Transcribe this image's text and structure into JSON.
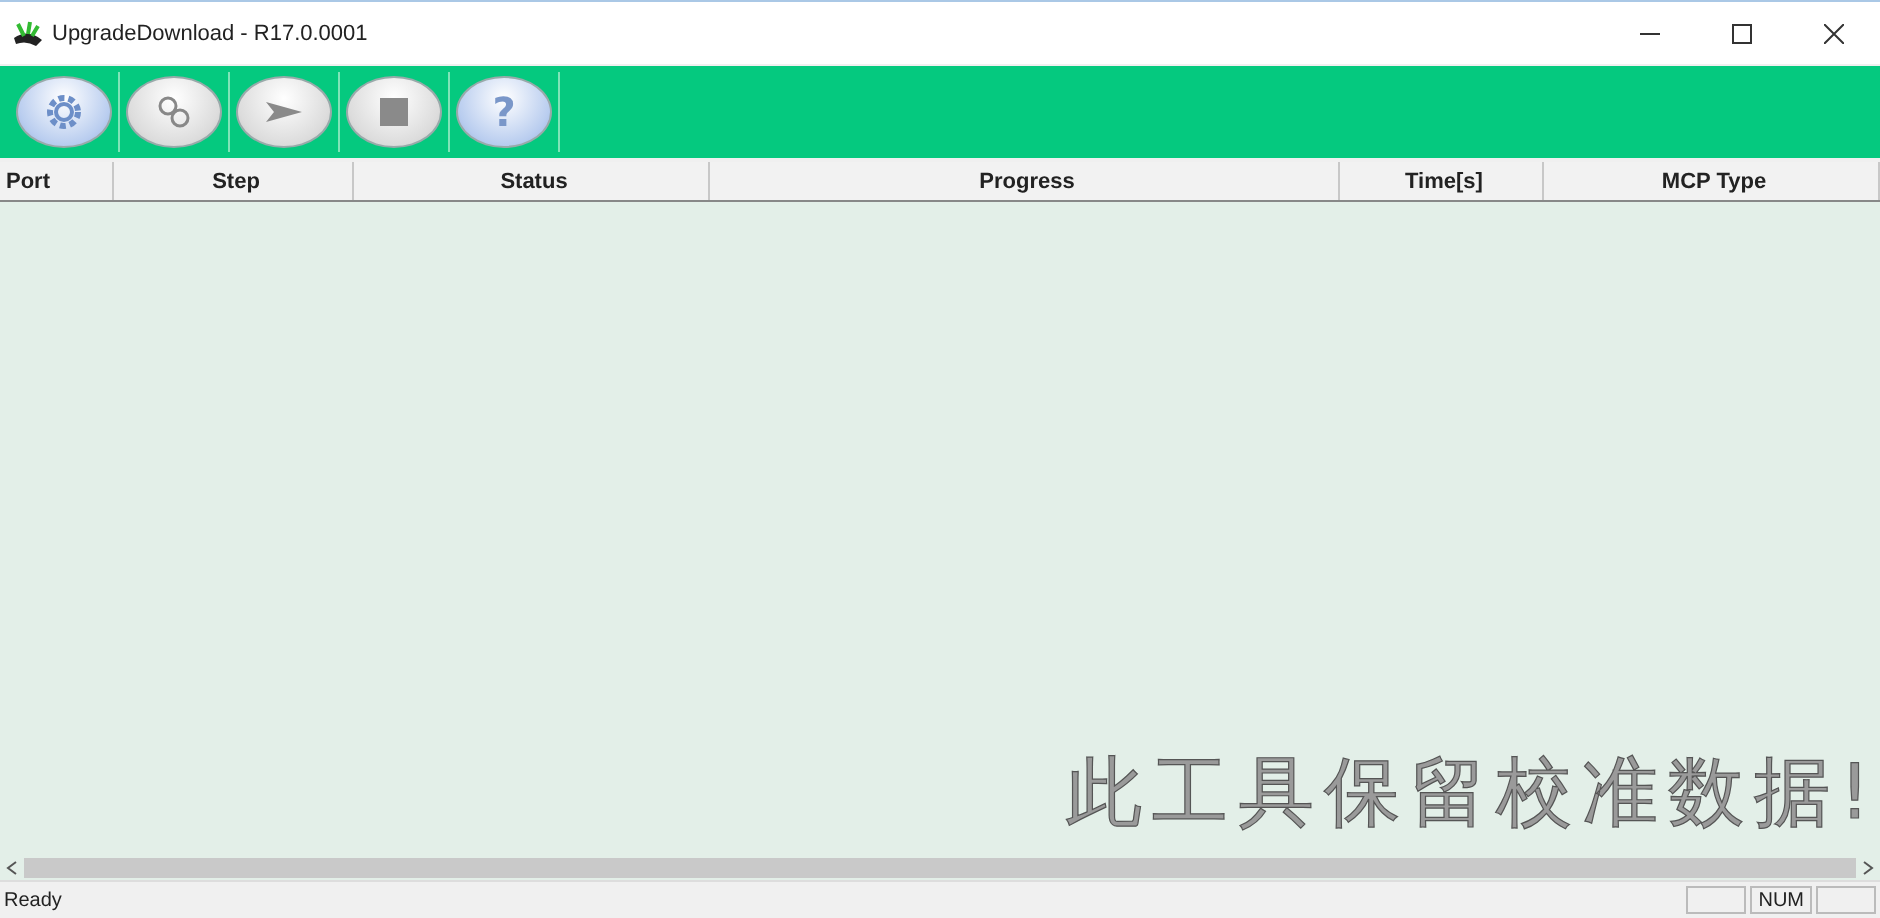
{
  "window": {
    "title": "UpgradeDownload - R17.0.0001"
  },
  "toolbar": {
    "buttons": [
      {
        "kind": "settings"
      },
      {
        "kind": "gears"
      },
      {
        "kind": "play"
      },
      {
        "kind": "stop"
      },
      {
        "kind": "help",
        "label": "?"
      }
    ]
  },
  "table": {
    "columns": [
      "Port",
      "Step",
      "Status",
      "Progress",
      "Time[s]",
      "MCP Type"
    ],
    "notice": "此工具保留校准数据!"
  },
  "status_bar": {
    "text": "Ready",
    "indicators": [
      "NUM"
    ]
  }
}
